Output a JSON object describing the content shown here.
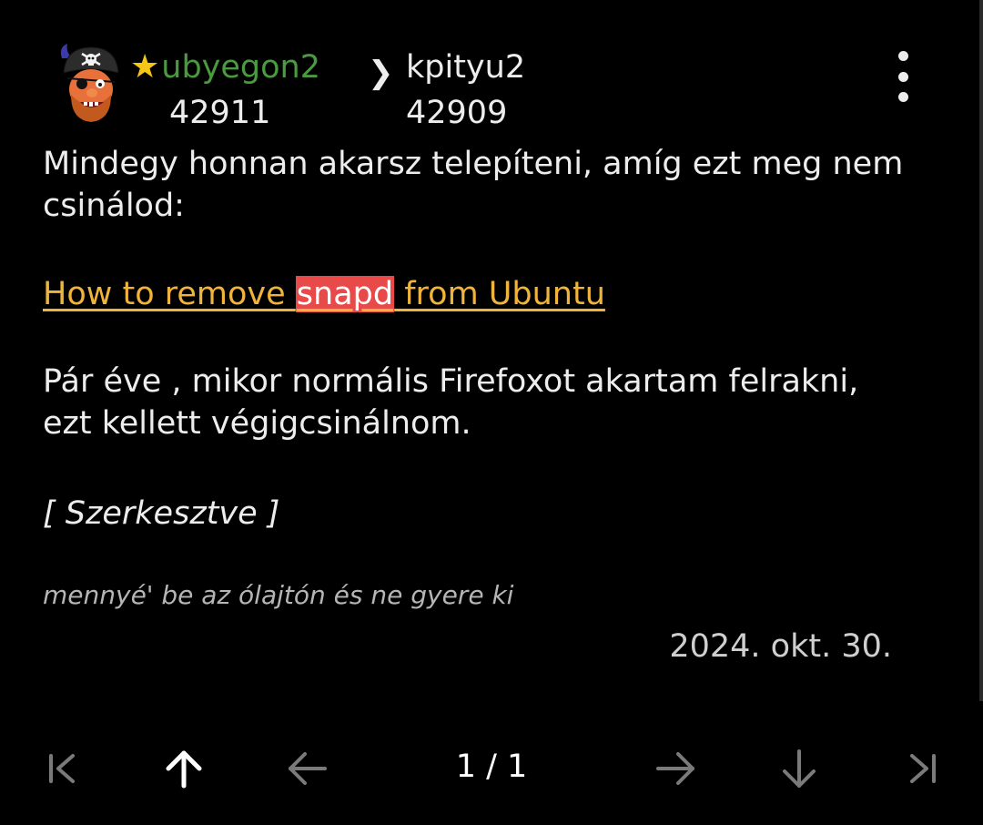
{
  "post": {
    "author": {
      "name": "ubyegon2",
      "score": "42911",
      "starred": true,
      "avatar_icon": "pirate-avatar",
      "name_color": "#4a9a3f"
    },
    "reply_to": {
      "arrow": "❯",
      "name": "kpityu2",
      "score": "42909"
    },
    "menu_icon": "more-vert-icon",
    "paragraph1": "Mindegy honnan akarsz telepíteni, amíg ezt meg nem csinálod:",
    "link": {
      "before": "How to remove ",
      "highlight": "snapd",
      "after": " from Ubuntu",
      "color": "#f0b43c",
      "highlight_color": "#e84a4a"
    },
    "paragraph2": "Pár éve , mikor normális Firefoxot akartam felrakni, ezt kellett végigcsinálnom.",
    "edited_label": "[ Szerkesztve ]",
    "signature": "mennyé' be az ólajtón és ne gyere ki",
    "date": "2024. okt. 30."
  },
  "navigation": {
    "first": "first-page-icon",
    "up": "arrow-up-icon",
    "prev": "arrow-left-icon",
    "page_indicator": "1 / 1",
    "next": "arrow-right-icon",
    "down": "arrow-down-icon",
    "last": "last-page-icon"
  }
}
